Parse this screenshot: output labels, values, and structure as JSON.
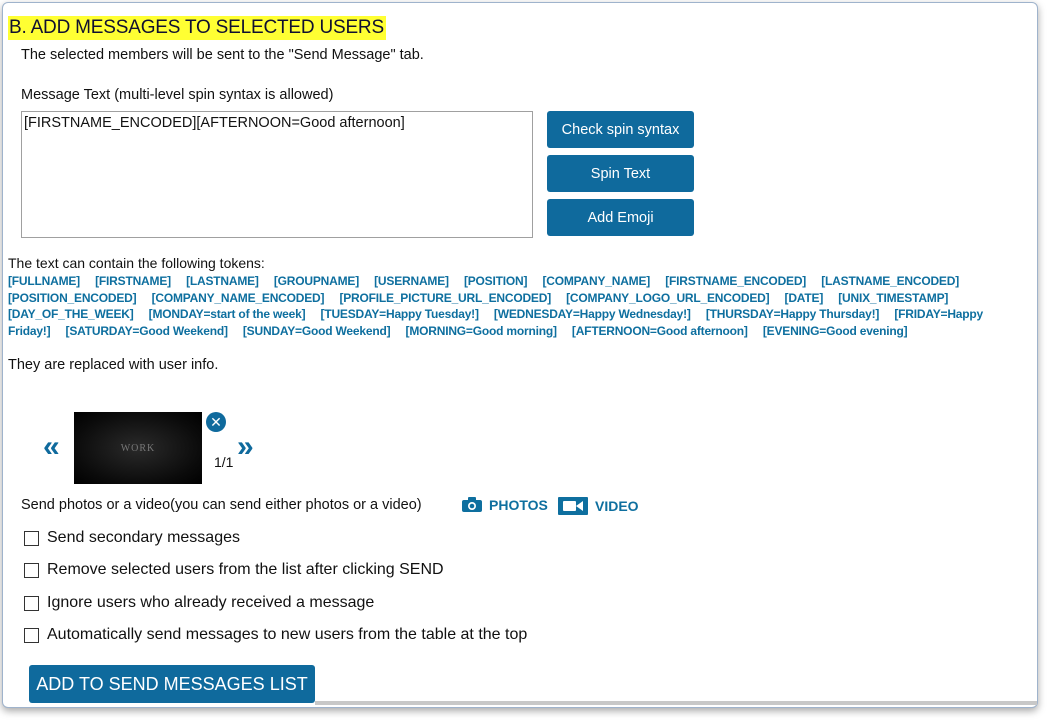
{
  "section": {
    "title": "B. ADD MESSAGES TO SELECTED USERS",
    "subtitle": "The selected members will be sent to the \"Send Message\" tab."
  },
  "message": {
    "label": "Message Text  (multi-level spin syntax is allowed)",
    "value": "[FIRSTNAME_ENCODED][AFTERNOON=Good afternoon]"
  },
  "buttons": {
    "check_spin": "Check spin syntax",
    "spin_text": "Spin Text",
    "add_emoji": "Add Emoji",
    "add_to_list": "ADD TO SEND MESSAGES LIST"
  },
  "tokens": {
    "intro": "The text can contain the following tokens:",
    "list": [
      "[FULLNAME]",
      "[FIRSTNAME]",
      "[LASTNAME]",
      "[GROUPNAME]",
      "[USERNAME]",
      "[POSITION]",
      "[COMPANY_NAME]",
      "[FIRSTNAME_ENCODED]",
      "[LASTNAME_ENCODED]",
      "[POSITION_ENCODED]",
      "[COMPANY_NAME_ENCODED]",
      "[PROFILE_PICTURE_URL_ENCODED]",
      "[COMPANY_LOGO_URL_ENCODED]",
      "[DATE]",
      "[UNIX_TIMESTAMP]",
      "[DAY_OF_THE_WEEK]",
      "[MONDAY=start of the week]",
      "[TUESDAY=Happy Tuesday!]",
      "[WEDNESDAY=Happy Wednesday!]",
      "[THURSDAY=Happy Thursday!]",
      "[FRIDAY=Happy Friday!]",
      "[SATURDAY=Good Weekend]",
      "[SUNDAY=Good Weekend]",
      "[MORNING=Good morning]",
      "[AFTERNOON=Good afternoon]",
      "[EVENING=Good evening]"
    ],
    "outro": "They are replaced with user info."
  },
  "media": {
    "prev_glyph": "«",
    "next_glyph": "»",
    "thumb_text": "WORK",
    "counter": "1/1",
    "description": "Send photos or a video(you can send either photos or a video)",
    "photos_label": "PHOTOS",
    "video_label": "VIDEO"
  },
  "options": [
    {
      "label": "Send secondary messages",
      "checked": false
    },
    {
      "label": "Remove selected users from the list after clicking SEND",
      "checked": false
    },
    {
      "label": "Ignore users who already received a message",
      "checked": false
    },
    {
      "label": "Automatically send messages to new users from the table at the top",
      "checked": false
    }
  ],
  "colors": {
    "accent": "#0f6a9d",
    "highlight": "#ffff33",
    "token": "#0e6f9f"
  }
}
